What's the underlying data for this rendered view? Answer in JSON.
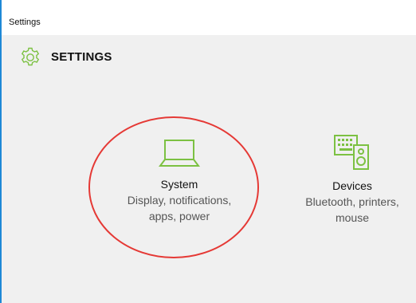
{
  "window": {
    "title": "Settings"
  },
  "header": {
    "icon": "gear-icon",
    "title": "SETTINGS"
  },
  "tiles": [
    {
      "icon": "laptop-icon",
      "name": "System",
      "description_line1": "Display, notifications,",
      "description_line2": "apps, power"
    },
    {
      "icon": "devices-icon",
      "name": "Devices",
      "description_line1": "Bluetooth, printers,",
      "description_line2": "mouse"
    }
  ],
  "colors": {
    "accent": "#7cc142",
    "window_border": "#1e88d6",
    "annotation": "#e53935",
    "background": "#f0f0f0"
  }
}
